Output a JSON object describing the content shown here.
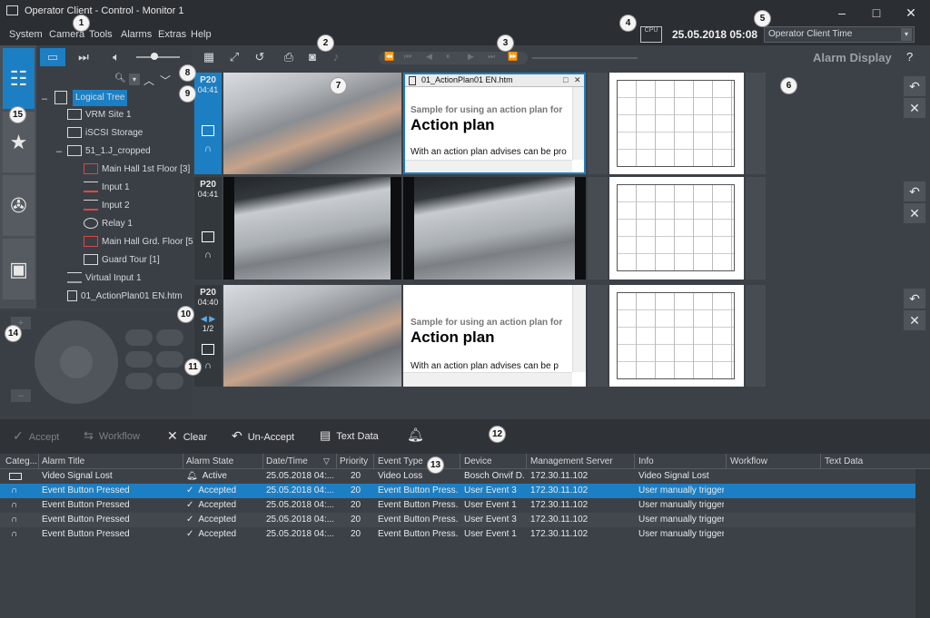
{
  "window": {
    "title": "Operator Client - Control - Monitor 1",
    "minimize": "–",
    "maximize": "□",
    "close": "✕"
  },
  "menu": [
    "System",
    "Camera",
    "Tools",
    "Alarms",
    "Extras",
    "Help"
  ],
  "status": {
    "cpu_label": "CPU",
    "datetime": "25.05.2018 05:08",
    "timezone": "Operator Client Time"
  },
  "alarm_display": {
    "title": "Alarm Display",
    "help": "?"
  },
  "playback": {
    "timestamp": "25.05.2018 05:08"
  },
  "callouts": [
    "1",
    "2",
    "3",
    "4",
    "5",
    "6",
    "7",
    "8",
    "9",
    "10",
    "11",
    "12",
    "13",
    "14",
    "15"
  ],
  "tree": {
    "root": "Logical Tree",
    "items": [
      {
        "label": "VRM Site 1",
        "icon": "server-icon"
      },
      {
        "label": "iSCSI Storage",
        "icon": "storage-icon"
      },
      {
        "label": "51_1.J_cropped",
        "icon": "map-icon"
      },
      {
        "label": "Main Hall 1st Floor [3]",
        "icon": "camera-icon"
      },
      {
        "label": "Input 1",
        "icon": "input-icon"
      },
      {
        "label": "Input 2",
        "icon": "input-icon"
      },
      {
        "label": "Relay 1",
        "icon": "relay-icon"
      },
      {
        "label": "Main Hall Grd. Floor [5",
        "icon": "camera-icon"
      },
      {
        "label": "Guard Tour [1]",
        "icon": "guard-tour-icon"
      },
      {
        "label": "Virtual Input 1",
        "icon": "virtual-input-icon"
      },
      {
        "label": "01_ActionPlan01 EN.htm",
        "icon": "document-icon"
      }
    ]
  },
  "grid": {
    "rows": [
      {
        "priority": "P20",
        "time": "04:41"
      },
      {
        "priority": "P20",
        "time": "04:41"
      },
      {
        "priority": "P20",
        "time": "04:40",
        "page": "1/2"
      }
    ],
    "doc_window_title": "01_ActionPlan01 EN.htm",
    "doc_sample": "Sample for using an action plan for",
    "doc_heading": "Action plan",
    "doc_body": "With an action plan advises can be pro",
    "doc_body2": "With an action plan advises can be p"
  },
  "alarm_toolbar": {
    "accept": "Accept",
    "workflow": "Workflow",
    "clear": "Clear",
    "unaccept": "Un-Accept",
    "textdata": "Text Data"
  },
  "table": {
    "headers": [
      "Categ...",
      "Alarm Title",
      "Alarm State",
      "Date/Time",
      "Priority",
      "Event Type",
      "Device",
      "Management Server",
      "Info",
      "Workflow",
      "Text Data"
    ],
    "rows": [
      {
        "cat": "camera-icon",
        "title": "Video Signal Lost",
        "state": "Active",
        "date": "25.05.2018 04:...",
        "priority": "20",
        "event": "Video Loss",
        "device": "Bosch Onvif D...",
        "server": "172.30.11.102",
        "info": "Video Signal Lost"
      },
      {
        "cat": "event-button-icon",
        "title": "Event Button Pressed",
        "state": "Accepted",
        "date": "25.05.2018 04:...",
        "priority": "20",
        "event": "Event Button Press...",
        "device": "User Event 3",
        "server": "172.30.11.102",
        "info": "User manually trigger..."
      },
      {
        "cat": "event-button-icon",
        "title": "Event Button Pressed",
        "state": "Accepted",
        "date": "25.05.2018 04:...",
        "priority": "20",
        "event": "Event Button Press...",
        "device": "User Event 1",
        "server": "172.30.11.102",
        "info": "User manually trigger..."
      },
      {
        "cat": "event-button-icon",
        "title": "Event Button Pressed",
        "state": "Accepted",
        "date": "25.05.2018 04:...",
        "priority": "20",
        "event": "Event Button Press...",
        "device": "User Event 3",
        "server": "172.30.11.102",
        "info": "User manually trigger..."
      },
      {
        "cat": "event-button-icon",
        "title": "Event Button Pressed",
        "state": "Accepted",
        "date": "25.05.2018 04:...",
        "priority": "20",
        "event": "Event Button Press...",
        "device": "User Event 1",
        "server": "172.30.11.102",
        "info": "User manually trigger..."
      }
    ],
    "selected_row": 1
  },
  "colors": {
    "accent": "#1c7fc4",
    "background": "#3c4147",
    "panel": "#2b2f33"
  }
}
